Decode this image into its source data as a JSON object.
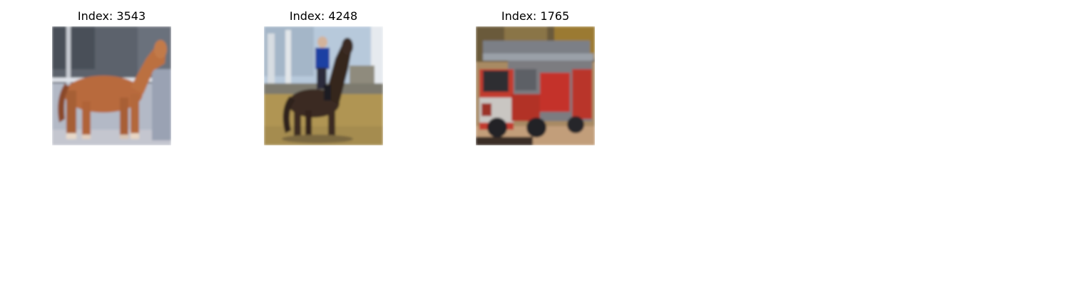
{
  "figure": {
    "panels": [
      {
        "title": "Index: 3543",
        "subject": "horse-standing-in-profile"
      },
      {
        "title": "Index: 4248",
        "subject": "rider-on-dark-horse"
      },
      {
        "title": "Index: 1765",
        "subject": "red-fire-truck"
      }
    ]
  }
}
